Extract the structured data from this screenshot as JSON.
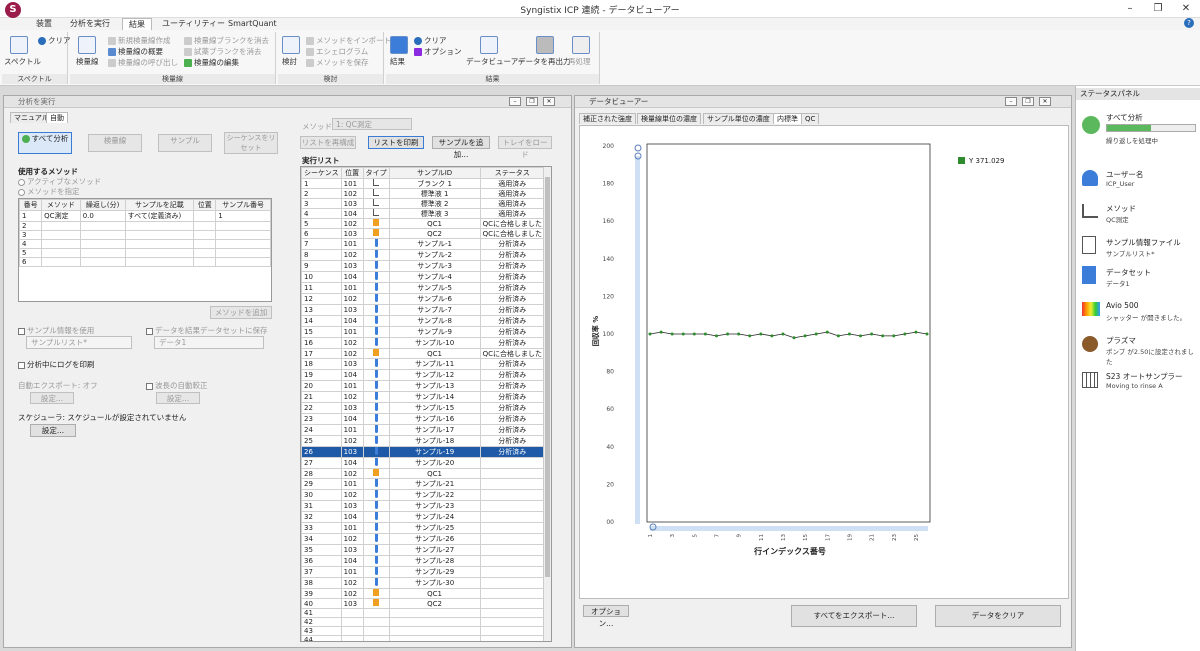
{
  "window": {
    "title": "Syngistix ICP 連続 - データビューアー"
  },
  "ribbon_tabs": [
    "装置",
    "分析を実行",
    "結果",
    "ユーティリティー",
    "SmartQuant"
  ],
  "ribbon": {
    "spectrum": {
      "big": "スペクトル",
      "clear": "クリア",
      "group": "スペクトル"
    },
    "calib": {
      "big": "検量線",
      "items": [
        "新規検量線作成",
        "検量線の概要",
        "検量線の呼び出し",
        "検量線ブランクを消去",
        "試薬ブランクを消去",
        "検量線の編集"
      ],
      "group": "検量線"
    },
    "review": {
      "big": "検討",
      "items": [
        "メソッドをインポート",
        "エシェログラム",
        "メソッドを保存"
      ],
      "group": "検討"
    },
    "results": {
      "big": "結果",
      "clear": "クリア",
      "options": "オプション",
      "viewer": "データビューアー",
      "reprint": "データを再出力",
      "reprocess": "再処理",
      "group": "結果"
    }
  },
  "run": {
    "title": "分析を実行",
    "tabs": [
      "マニュアル",
      "自動"
    ],
    "btn_all": "すべて分析",
    "btn_blank": "検量線",
    "btn_sample": "サンプル",
    "btn_reset": "シーケンスをリセット",
    "method_label": "使用するメソッド",
    "radio_active": "アクティブなメソッド",
    "radio_specify": "メソッドを指定",
    "method_cols": [
      "番号",
      "メソッド",
      "繰返し(分)",
      "サンプルを記載",
      "位置",
      "サンプル番号"
    ],
    "method_row": [
      "1",
      "QC測定",
      "0.0",
      "すべて(定義済み)",
      "",
      "1"
    ],
    "extra_rows": [
      "2",
      "3",
      "4",
      "5",
      "6"
    ],
    "add_method": "メソッドを追加",
    "use_sample_info": "サンプル情報を使用",
    "sample_list": "サンプルリスト*",
    "save_dataset": "データを結果データセットに保存",
    "dataset": "データ1",
    "print_log": "分析中にログを印刷",
    "auto_export": "自動エクスポート: オフ",
    "auto_wave": "波長の自動較正",
    "settings": "設定...",
    "scheduler": "スケジューラ: スケジュールが設定されていません",
    "settings2": "設定..."
  },
  "runlist": {
    "method_label": "メソッド",
    "method_value": "1: QC測定",
    "btn_rebuild": "リストを再構成",
    "btn_print": "リストを印刷",
    "btn_add": "サンプルを追加...",
    "btn_tray": "トレイをロード",
    "heading": "実行リスト",
    "cols": [
      "シーケンス",
      "位置",
      "タイプ",
      "サンプルID",
      "ステータス"
    ],
    "rows": [
      [
        "1",
        "101",
        "cal",
        "ブランク 1",
        "適用済み"
      ],
      [
        "2",
        "102",
        "cal",
        "標準液 1",
        "適用済み"
      ],
      [
        "3",
        "103",
        "cal",
        "標準液 2",
        "適用済み"
      ],
      [
        "4",
        "104",
        "cal",
        "標準液 3",
        "適用済み"
      ],
      [
        "5",
        "102",
        "qc",
        "QC1",
        "QCに合格しました"
      ],
      [
        "6",
        "103",
        "qc",
        "QC2",
        "QCに合格しました"
      ],
      [
        "7",
        "101",
        "s",
        "サンプル-1",
        "分析済み"
      ],
      [
        "8",
        "102",
        "s",
        "サンプル-2",
        "分析済み"
      ],
      [
        "9",
        "103",
        "s",
        "サンプル-3",
        "分析済み"
      ],
      [
        "10",
        "104",
        "s",
        "サンプル-4",
        "分析済み"
      ],
      [
        "11",
        "101",
        "s",
        "サンプル-5",
        "分析済み"
      ],
      [
        "12",
        "102",
        "s",
        "サンプル-6",
        "分析済み"
      ],
      [
        "13",
        "103",
        "s",
        "サンプル-7",
        "分析済み"
      ],
      [
        "14",
        "104",
        "s",
        "サンプル-8",
        "分析済み"
      ],
      [
        "15",
        "101",
        "s",
        "サンプル-9",
        "分析済み"
      ],
      [
        "16",
        "102",
        "s",
        "サンプル-10",
        "分析済み"
      ],
      [
        "17",
        "102",
        "qc",
        "QC1",
        "QCに合格しました"
      ],
      [
        "18",
        "103",
        "s",
        "サンプル-11",
        "分析済み"
      ],
      [
        "19",
        "104",
        "s",
        "サンプル-12",
        "分析済み"
      ],
      [
        "20",
        "101",
        "s",
        "サンプル-13",
        "分析済み"
      ],
      [
        "21",
        "102",
        "s",
        "サンプル-14",
        "分析済み"
      ],
      [
        "22",
        "103",
        "s",
        "サンプル-15",
        "分析済み"
      ],
      [
        "23",
        "104",
        "s",
        "サンプル-16",
        "分析済み"
      ],
      [
        "24",
        "101",
        "s",
        "サンプル-17",
        "分析済み"
      ],
      [
        "25",
        "102",
        "s",
        "サンプル-18",
        "分析済み"
      ],
      [
        "26",
        "103",
        "s",
        "サンプル-19",
        "分析済み"
      ],
      [
        "27",
        "104",
        "s",
        "サンプル-20",
        ""
      ],
      [
        "28",
        "102",
        "qc",
        "QC1",
        ""
      ],
      [
        "29",
        "101",
        "s",
        "サンプル-21",
        ""
      ],
      [
        "30",
        "102",
        "s",
        "サンプル-22",
        ""
      ],
      [
        "31",
        "103",
        "s",
        "サンプル-23",
        ""
      ],
      [
        "32",
        "104",
        "s",
        "サンプル-24",
        ""
      ],
      [
        "33",
        "101",
        "s",
        "サンプル-25",
        ""
      ],
      [
        "34",
        "102",
        "s",
        "サンプル-26",
        ""
      ],
      [
        "35",
        "103",
        "s",
        "サンプル-27",
        ""
      ],
      [
        "36",
        "104",
        "s",
        "サンプル-28",
        ""
      ],
      [
        "37",
        "101",
        "s",
        "サンプル-29",
        ""
      ],
      [
        "38",
        "102",
        "s",
        "サンプル-30",
        ""
      ],
      [
        "39",
        "102",
        "qc",
        "QC1",
        ""
      ],
      [
        "40",
        "103",
        "qc",
        "QC2",
        ""
      ],
      [
        "41",
        "",
        "",
        "",
        ""
      ],
      [
        "42",
        "",
        "",
        "",
        ""
      ],
      [
        "43",
        "",
        "",
        "",
        ""
      ],
      [
        "44",
        "",
        "",
        "",
        ""
      ],
      [
        "45",
        "",
        "",
        "",
        ""
      ]
    ],
    "selected_row": 25
  },
  "viewer": {
    "title": "データビューアー",
    "tabs": [
      "補正された強度",
      "検量線単位の濃度",
      "サンプル単位の濃度",
      "内標準",
      "QC"
    ],
    "active_tab": 3,
    "btn_options": "オプション...",
    "btn_export": "すべてをエクスポート...",
    "btn_clear": "データをクリア"
  },
  "chart_data": {
    "type": "line",
    "title": "",
    "xlabel": "行インデックス番号",
    "ylabel": "回収率 %",
    "ylim": [
      0,
      200
    ],
    "yticks": [
      "00",
      "20",
      "40",
      "60",
      "80",
      "100",
      "120",
      "140",
      "160",
      "180",
      "200"
    ],
    "xticks": [
      "1",
      "3",
      "5",
      "7",
      "9",
      "11",
      "13",
      "15",
      "17",
      "19",
      "21",
      "23",
      "25"
    ],
    "x": [
      1,
      2,
      3,
      4,
      5,
      6,
      7,
      8,
      9,
      10,
      11,
      12,
      13,
      14,
      15,
      16,
      17,
      18,
      19,
      20,
      21,
      22,
      23,
      24,
      25,
      26
    ],
    "series": [
      {
        "name": "Y 371.029",
        "color": "#2e8b2e",
        "values": [
          100,
          101,
          100,
          100,
          100,
          100,
          99,
          100,
          100,
          99,
          100,
          99,
          100,
          98,
          99,
          100,
          101,
          99,
          100,
          99,
          100,
          99,
          99,
          100,
          101,
          100
        ]
      }
    ],
    "legend": "top-right",
    "grid": false
  },
  "status": {
    "title": "ステータスパネル",
    "items": [
      {
        "title": "すべて分析",
        "sub": "繰り返しを処理中",
        "progress": 0.5,
        "color": "#5cb85c"
      },
      {
        "title": "ユーザー名",
        "sub": "ICP_User"
      },
      {
        "title": "メソッド",
        "sub": "QC測定"
      },
      {
        "title": "サンプル情報ファイル",
        "sub": "サンプルリスト*"
      },
      {
        "title": "データセット",
        "sub": "データ1"
      },
      {
        "title": "Avio 500",
        "sub": "シャッター が開きました。"
      },
      {
        "title": "プラズマ",
        "sub": "ポンプ が2.50に設定されました"
      },
      {
        "title": "S23 オートサンプラー",
        "sub": "Moving to rinse A"
      }
    ]
  }
}
